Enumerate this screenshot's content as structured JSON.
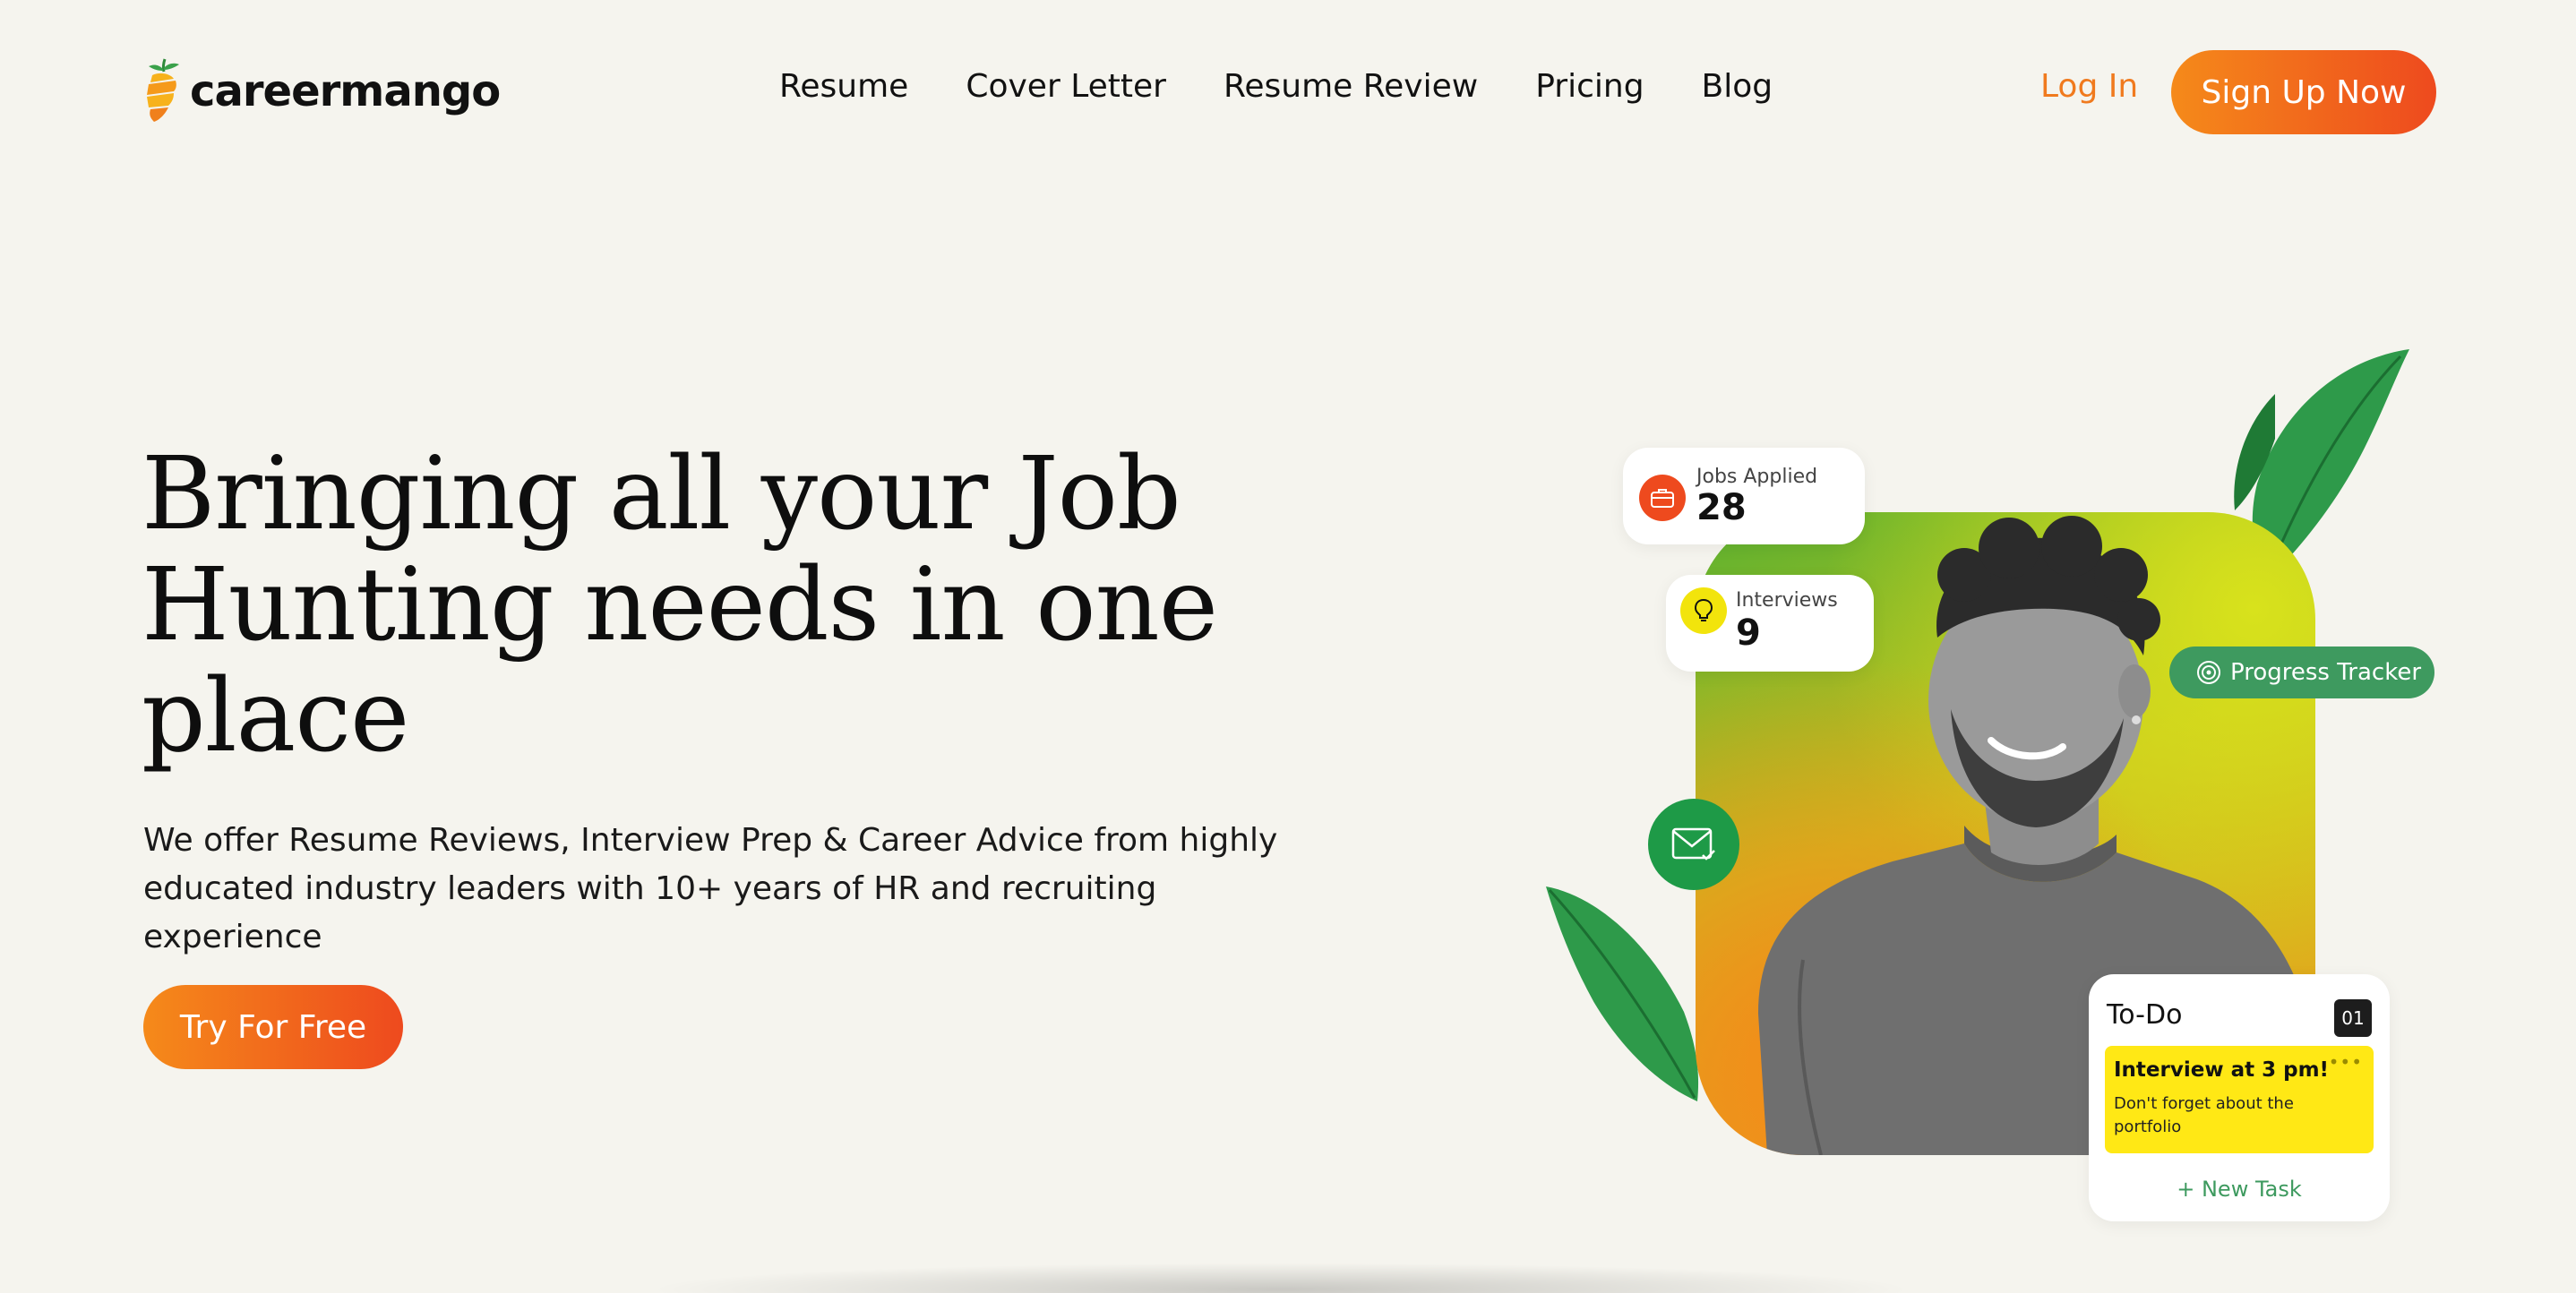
{
  "brand": {
    "name": "careermango"
  },
  "nav": {
    "items": [
      {
        "label": "Resume"
      },
      {
        "label": "Cover Letter"
      },
      {
        "label": "Resume Review"
      },
      {
        "label": "Pricing"
      },
      {
        "label": "Blog"
      }
    ],
    "login_label": "Log In",
    "signup_label": "Sign Up Now"
  },
  "hero": {
    "title": "Bringing all your Job Hunting needs in one place",
    "subtitle": "We offer Resume Reviews, Interview Prep & Career Advice from highly educated industry leaders with 10+ years of HR and recruiting experience",
    "cta_label": "Try For Free"
  },
  "stats": {
    "jobs_applied": {
      "label": "Jobs Applied",
      "value": "28"
    },
    "interviews": {
      "label": "Interviews",
      "value": "9"
    }
  },
  "progress_tracker": {
    "label": "Progress Tracker"
  },
  "todo": {
    "title": "To-Do",
    "count": "01",
    "note_title": "Interview at 3 pm!",
    "note_body": "Don't forget about the portfolio",
    "new_task_label": "+ New Task"
  },
  "colors": {
    "accent_orange": "#f58a1a",
    "accent_red_orange": "#ee4a1e",
    "green": "#3e9a5f",
    "note_yellow": "#ffe815",
    "background": "#f5f4ee"
  },
  "icons": [
    "mango-logo-icon",
    "briefcase-icon",
    "lightbulb-icon",
    "target-icon",
    "mail-check-icon",
    "more-dots-icon"
  ]
}
